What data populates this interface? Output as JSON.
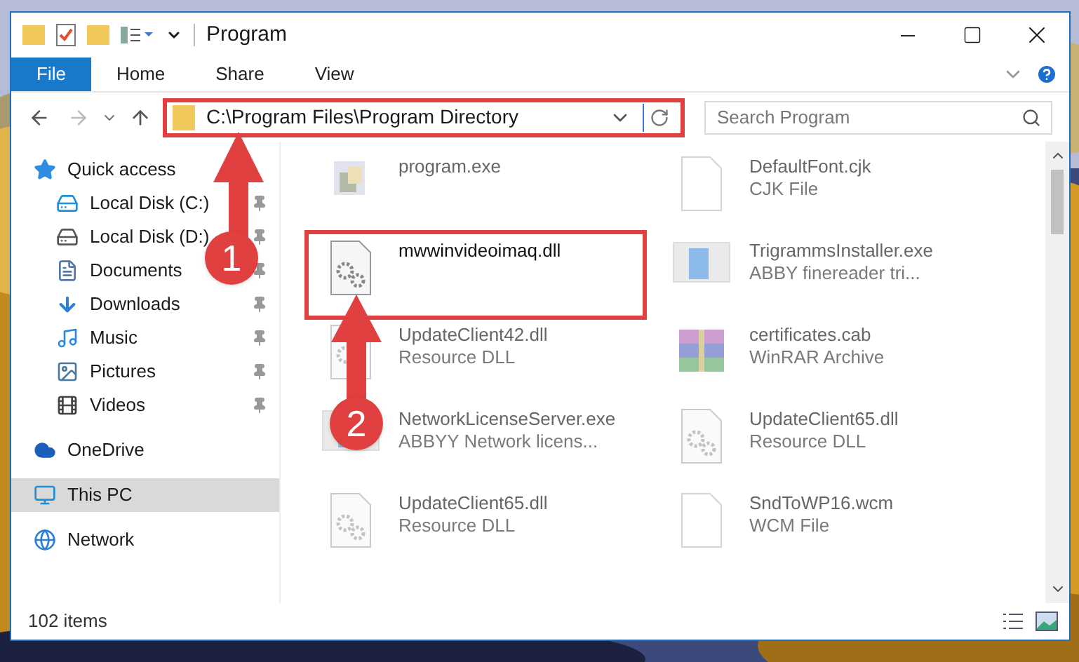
{
  "window": {
    "title": "Program"
  },
  "ribbon_tabs": [
    {
      "label": "File",
      "selected": true
    },
    {
      "label": "Home",
      "selected": false
    },
    {
      "label": "Share",
      "selected": false
    },
    {
      "label": "View",
      "selected": false
    }
  ],
  "address": {
    "path": "C:\\Program Files\\Program Directory",
    "highlighted": true
  },
  "search": {
    "placeholder": "Search Program"
  },
  "navigation": [
    {
      "label": "Quick access",
      "kind": "star",
      "selected": false,
      "children": [
        {
          "label": "Local Disk (C:)",
          "kind": "system-drive",
          "pinned": true,
          "selected": false
        },
        {
          "label": "Local Disk (D:)",
          "kind": "drive",
          "pinned": true,
          "selected": false
        },
        {
          "label": "Documents",
          "kind": "document",
          "pinned": true,
          "selected": false
        },
        {
          "label": "Downloads",
          "kind": "download",
          "pinned": true,
          "selected": false
        },
        {
          "label": "Music",
          "kind": "music",
          "pinned": true,
          "selected": false
        },
        {
          "label": "Pictures",
          "kind": "pictures",
          "pinned": true,
          "selected": false
        },
        {
          "label": "Videos",
          "kind": "videos",
          "pinned": true,
          "selected": false
        }
      ]
    },
    {
      "label": "OneDrive",
      "kind": "cloud",
      "selected": false
    },
    {
      "label": "This PC",
      "kind": "pc",
      "selected": true
    },
    {
      "label": "Network",
      "kind": "network",
      "selected": false
    }
  ],
  "files": [
    {
      "name": "program.exe",
      "kind": "exe",
      "blurred": true,
      "highlighted": false
    },
    {
      "name": "DefaultFont.cjk",
      "type": "CJK File",
      "kind": "blank",
      "blurred": true,
      "highlighted": false
    },
    {
      "name": "mwwinvideoimaq.dll",
      "kind": "gear",
      "blurred": false,
      "highlighted": true
    },
    {
      "name": "TrigrammsInstaller.exe",
      "type": "ABBY finereader tri...",
      "kind": "installer",
      "blurred": true,
      "highlighted": false
    },
    {
      "name": "UpdateClient42.dll",
      "type": "Resource DLL",
      "kind": "gear",
      "blurred": true,
      "highlighted": false
    },
    {
      "name": "certificates.cab",
      "type": "WinRAR Archive",
      "kind": "archive",
      "blurred": true,
      "highlighted": false
    },
    {
      "name": "NetworkLicenseServer.exe",
      "type": "ABBYY Network licens...",
      "kind": "installer",
      "blurred": true,
      "highlighted": false
    },
    {
      "name": "UpdateClient65.dll",
      "type": "Resource DLL",
      "kind": "gear",
      "blurred": true,
      "highlighted": false
    },
    {
      "name": "UpdateClient65.dll",
      "type": "Resource DLL",
      "kind": "gear",
      "blurred": true,
      "highlighted": false
    },
    {
      "name": "SndToWP16.wcm",
      "type": "WCM File",
      "kind": "blank",
      "blurred": true,
      "highlighted": false
    }
  ],
  "status_bar": {
    "item_count": "102 items"
  },
  "annotations": [
    {
      "label": "1"
    },
    {
      "label": "2"
    }
  ]
}
